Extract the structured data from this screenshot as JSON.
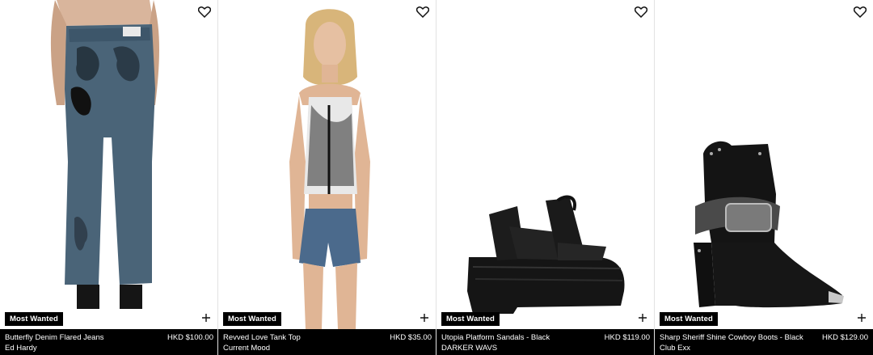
{
  "products": [
    {
      "badge": "Most Wanted",
      "name": "Butterfly Denim Flared Jeans",
      "price": "HKD $100.00",
      "brand": "Ed Hardy"
    },
    {
      "badge": "Most Wanted",
      "name": "Revved Love Tank Top",
      "price": "HKD $35.00",
      "brand": "Current Mood"
    },
    {
      "badge": "Most Wanted",
      "name": "Utopia Platform Sandals - Black",
      "price": "HKD $119.00",
      "brand": "DARKER WAVS"
    },
    {
      "badge": "Most Wanted",
      "name": "Sharp Sheriff Shine Cowboy Boots - Black",
      "price": "HKD $129.00",
      "brand": "Club Exx"
    }
  ],
  "icons": {
    "wishlist": "heart-icon",
    "add": "plus-icon"
  },
  "colors": {
    "bar": "#000000",
    "text": "#ffffff"
  }
}
